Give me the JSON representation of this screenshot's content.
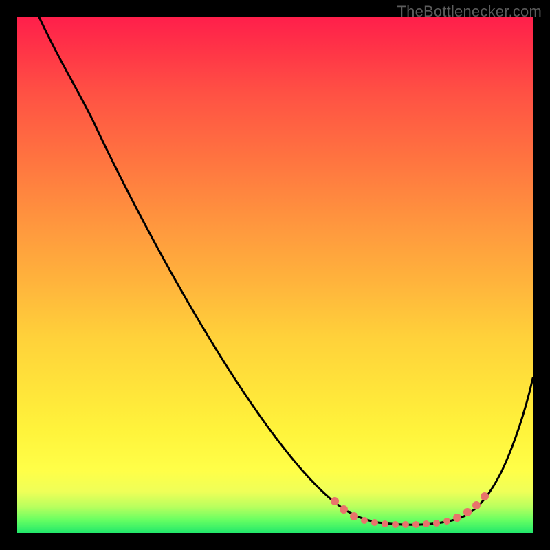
{
  "watermark": "TheBottlenecker.com",
  "colors": {
    "background": "#000000",
    "gradient_top": "#ff1f4b",
    "gradient_mid": "#ffd13a",
    "gradient_bottom": "#22e86b",
    "curve": "#000000",
    "dots": "#e8736b",
    "watermark_text": "#5c5c5c"
  },
  "chart_data": {
    "type": "line",
    "title": "",
    "xlabel": "",
    "ylabel": "",
    "xlim": [
      0,
      100
    ],
    "ylim": [
      0,
      100
    ],
    "description": "Single black curve on a vertical red-to-green gradient. Curve enters top-left, descends roughly linearly to a broad minimum near x≈70–85 at the bottom (green zone), then rises toward the right edge. The near-minimum portion of the curve is overlaid with coral dots.",
    "series": [
      {
        "name": "bottleneck-curve",
        "x": [
          4,
          10,
          15,
          20,
          30,
          40,
          50,
          58,
          62,
          66,
          70,
          74,
          78,
          82,
          86,
          90,
          94,
          100
        ],
        "values": [
          100,
          92,
          85,
          80,
          62,
          44,
          27,
          14,
          9,
          5,
          3,
          2,
          2,
          2,
          3,
          6,
          12,
          30
        ]
      }
    ],
    "highlight_region": {
      "name": "optimal-zone-dots",
      "x_range": [
        62,
        90
      ],
      "style": "coral-dots-along-curve"
    },
    "background_gradient": {
      "orientation": "vertical",
      "stops": [
        {
          "pos": 0.0,
          "color": "#ff1f4b"
        },
        {
          "pos": 0.5,
          "color": "#ffb53c"
        },
        {
          "pos": 0.9,
          "color": "#ffff48"
        },
        {
          "pos": 1.0,
          "color": "#22e86b"
        }
      ]
    }
  }
}
